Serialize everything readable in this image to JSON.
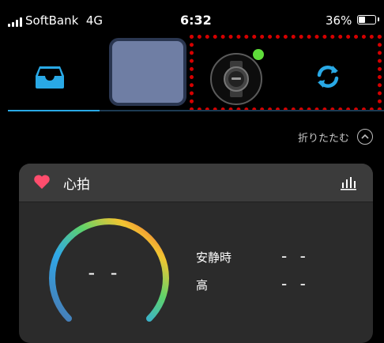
{
  "status_bar": {
    "carrier": "SoftBank",
    "network": "4G",
    "time": "6:32",
    "battery": "36%",
    "battery_level": 0.36
  },
  "tabs": [
    {
      "name": "inbox",
      "icon": "inbox-tray-icon",
      "active": true
    },
    {
      "name": "placeholder",
      "icon": "blank-tile"
    },
    {
      "name": "watch",
      "icon": "smartwatch-icon",
      "connected": true
    },
    {
      "name": "sync",
      "icon": "sync-icon"
    }
  ],
  "collapse": {
    "label": "折りたたむ",
    "icon": "chevron-up-icon"
  },
  "heart_card": {
    "title": "心拍",
    "icon": "heart-icon",
    "chart_icon": "bar-chart-icon",
    "gauge_value": "- -",
    "resting_label": "安静時",
    "resting_value": "- -",
    "high_label": "高",
    "high_value": "- -"
  },
  "colors": {
    "accent": "#29a9e6",
    "heart": "#ff4d6d",
    "connected_dot": "#5fdc3a",
    "highlight": "#d50000"
  }
}
